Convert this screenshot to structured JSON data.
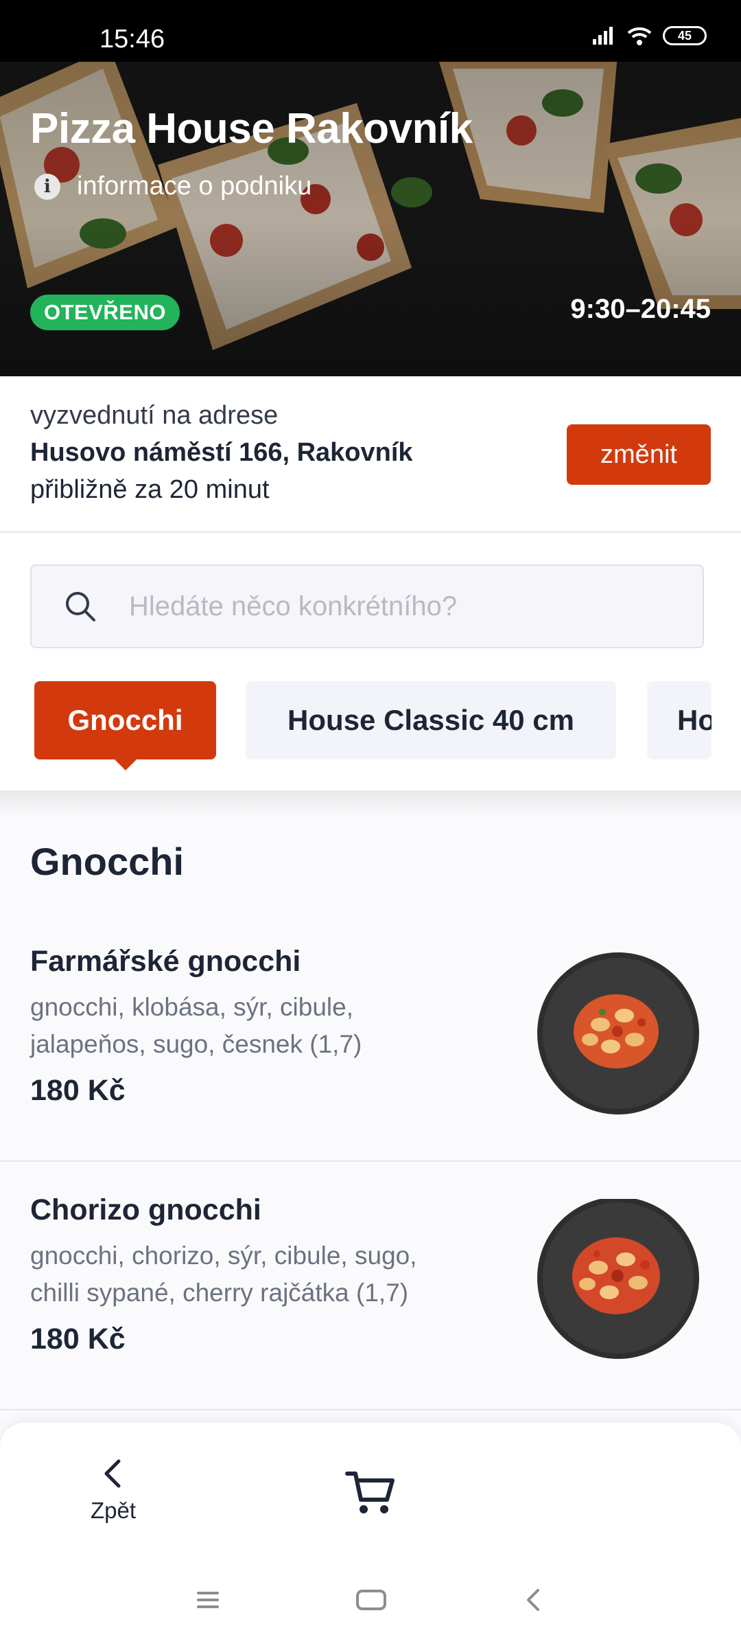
{
  "status_bar": {
    "time": "15:46",
    "battery": "45"
  },
  "restaurant": {
    "name": "Pizza House Rakovník",
    "info_link": "informace o podniku",
    "status_badge": "OTEVŘENO",
    "status_color": "#22b35b",
    "hours": "9:30–20:45"
  },
  "pickup": {
    "label": "vyzvednutí na adrese",
    "address": "Husovo náměstí 166, Rakovník",
    "eta": "přibližně za 20 minut",
    "change_label": "změnit"
  },
  "search": {
    "placeholder": "Hledáte něco konkrétního?"
  },
  "categories": [
    {
      "label": "Gnocchi",
      "active": true
    },
    {
      "label": "House Classic 40 cm",
      "active": false
    },
    {
      "label": "Ho",
      "active": false
    }
  ],
  "section": {
    "title": "Gnocchi"
  },
  "menu_items": [
    {
      "name": "Farmářské gnocchi",
      "description": "gnocchi, klobása, sýr, cibule, jalapeňos, sugo, česnek (1,7)",
      "price": "180 Kč"
    },
    {
      "name": "Chorizo gnocchi",
      "description": "gnocchi, chorizo, sýr, cibule, sugo, chilli sypané, cherry rajčátka (1,7)",
      "price": "180 Kč"
    }
  ],
  "bottom_nav": {
    "back_label": "Zpět",
    "cart_icon": "cart-icon"
  },
  "colors": {
    "accent": "#d23a0e",
    "text_dark": "#1d2536",
    "text_muted": "#6b7280"
  }
}
